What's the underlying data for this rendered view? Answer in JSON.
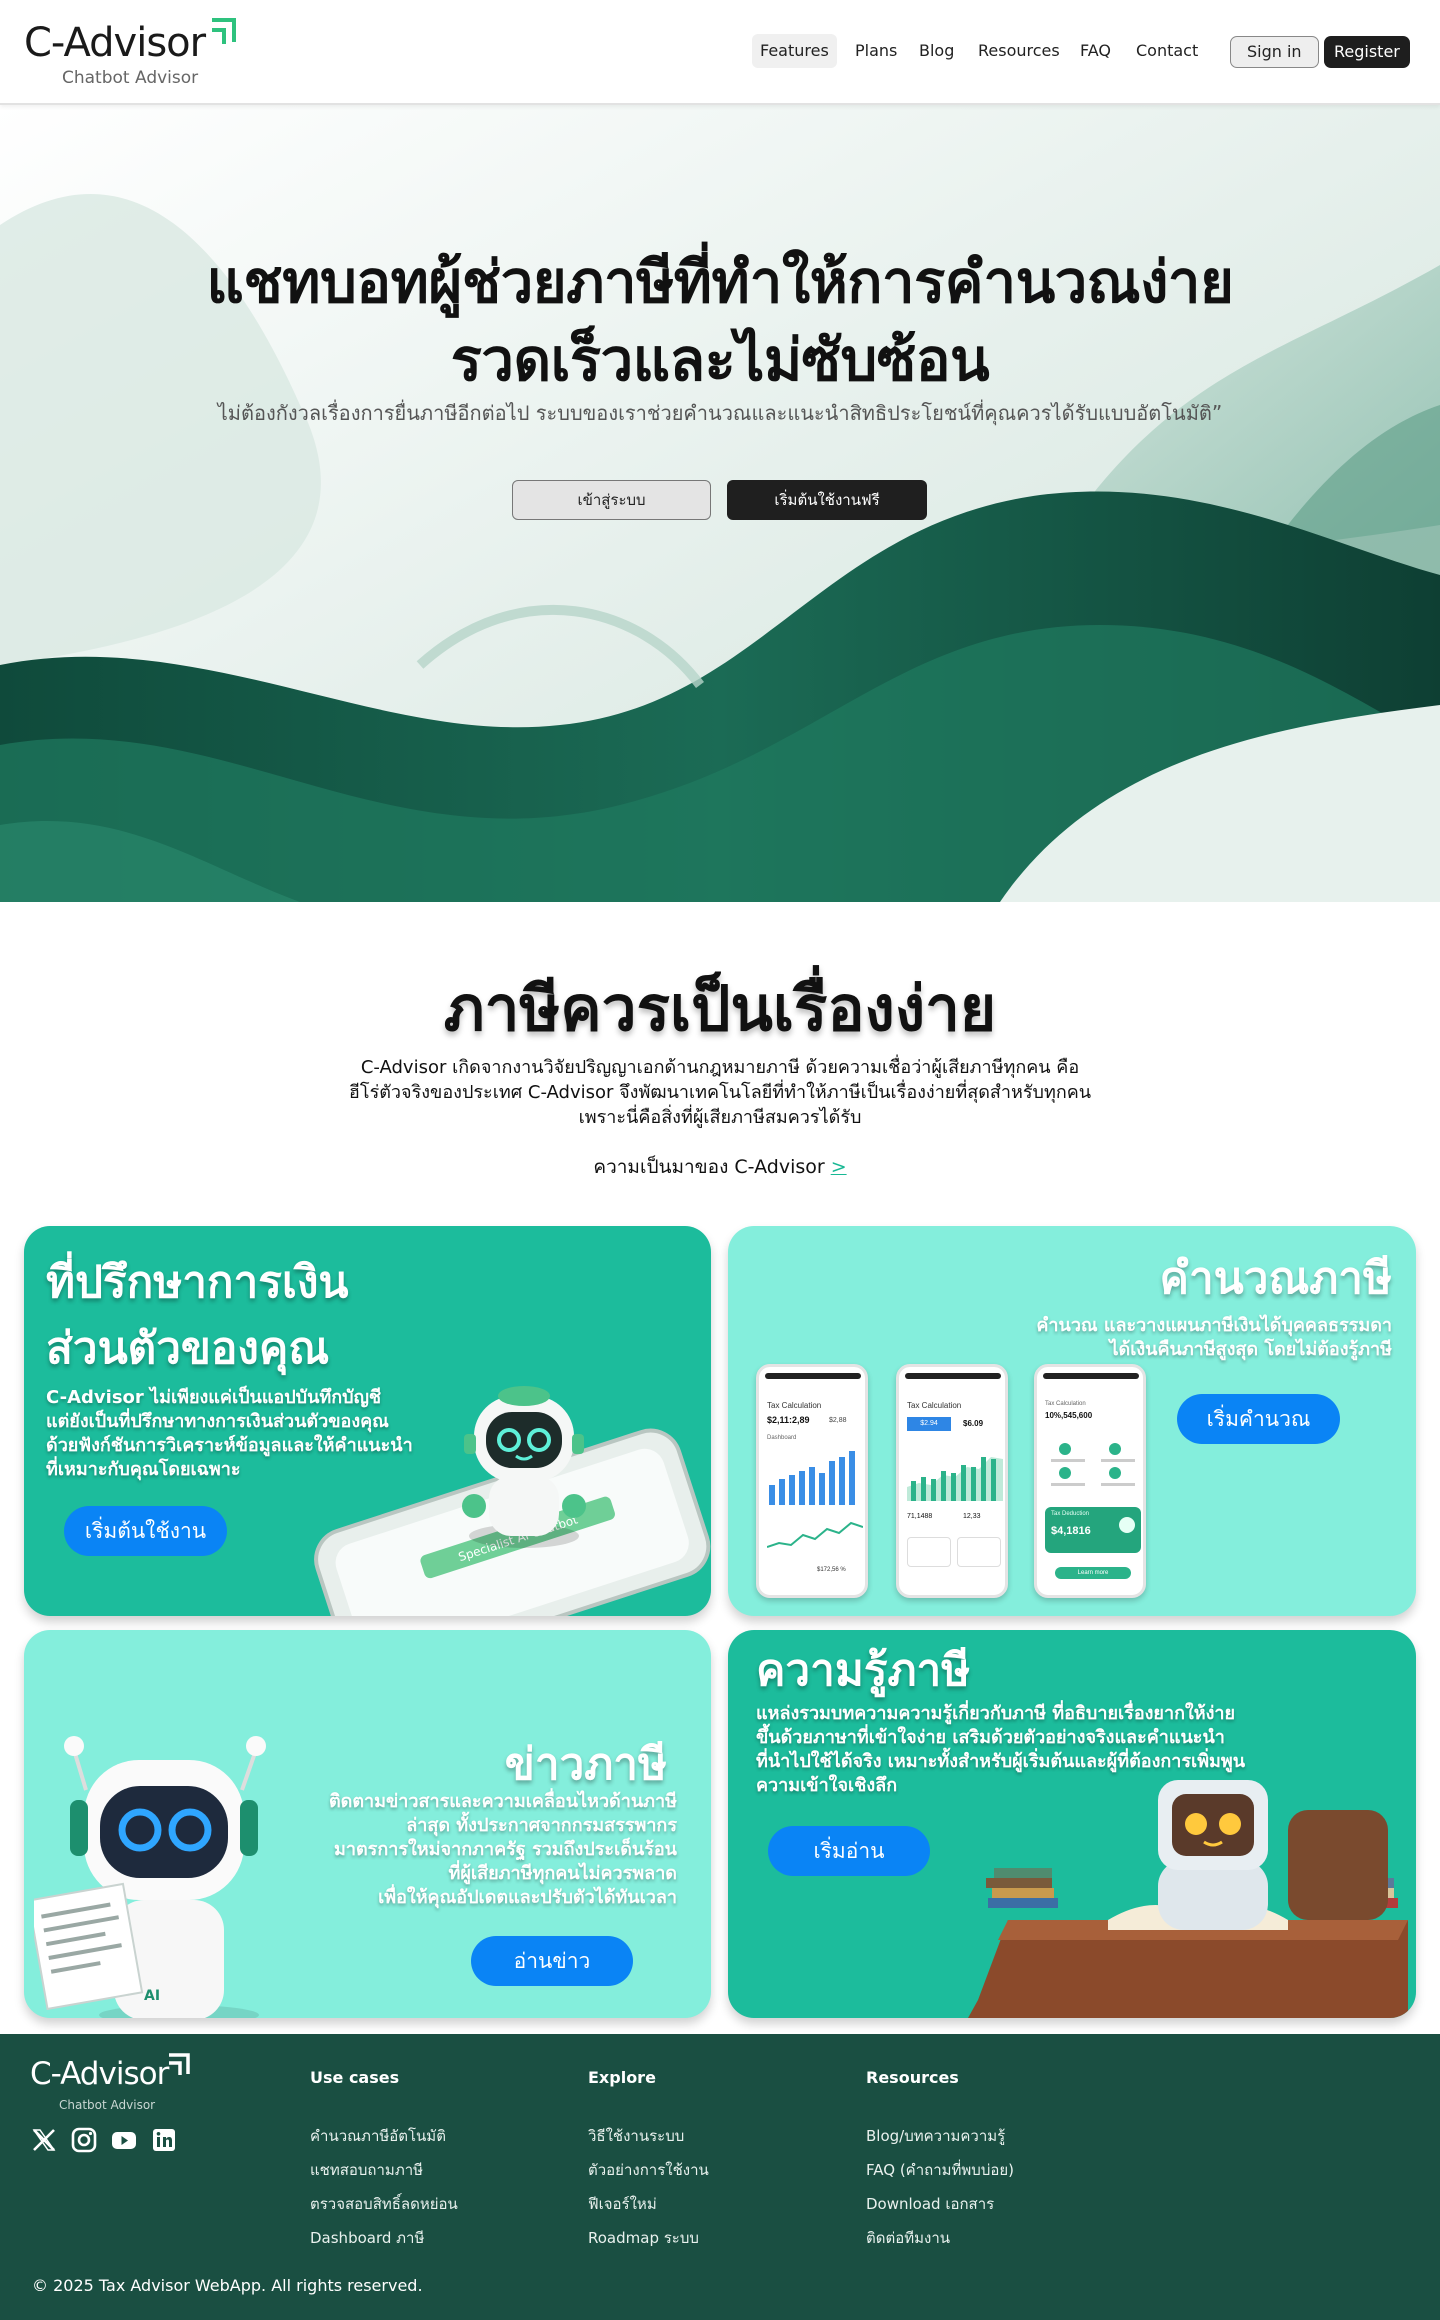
{
  "brand": {
    "name": "C-Advisor",
    "tagline": "Chatbot Advisor"
  },
  "nav": {
    "items": [
      "Features",
      "Plans",
      "Blog",
      "Resources",
      "FAQ",
      "Contact"
    ],
    "active": "Features",
    "signin": "Sign in",
    "register": "Register"
  },
  "hero": {
    "title_line1": "แชทบอทผู้ช่วยภาษีที่ทำให้การคำนวณง่าย",
    "title_line2": "รวดเร็วและไม่ซับซ้อน",
    "subtitle": "ไม่ต้องกังวลเรื่องการยื่นภาษีอีกต่อไป ระบบของเราช่วยคำนวณและแนะนำสิทธิประโยชน์ที่คุณควรได้รับแบบอัตโนมัติ”",
    "login_button": "เข้าสู่ระบบ",
    "start_button": "เริ่มต้นใช้งานฟรี"
  },
  "intro": {
    "title": "ภาษีควรเป็นเรื่องง่าย",
    "text_line1": "C-Advisor เกิดจากงานวิจัยปริญญาเอกด้านกฎหมายภาษี ด้วยความเชื่อว่าผู้เสียภาษีทุกคน คือ",
    "text_line2": "ฮีโร่ตัวจริงของประเทศ C-Advisor จึงพัฒนาเทคโนโลยีที่ทำให้ภาษีเป็นเรื่องง่ายที่สุดสำหรับทุกคน",
    "text_line3": "เพราะนี่คือสิ่งที่ผู้เสียภาษีสมควรได้รับ",
    "link": "ความเป็นมาของ C-Advisor",
    "link_chevron": ">"
  },
  "cards": {
    "advisor": {
      "title_line1": "ที่ปรึกษาการเงิน",
      "title_line2": "ส่วนตัวของคุณ",
      "text_line1": "C-Advisor ไม่เพียงแค่เป็นแอปบันทึกบัญชี",
      "text_line2": "แต่ยังเป็นที่ปรึกษาทางการเงินส่วนตัวของคุณ",
      "text_line3": "ด้วยฟังก์ชันการวิเคราะห์ข้อมูลและให้คำแนะนำ",
      "text_line4": "ที่เหมาะกับคุณโดยเฉพาะ",
      "button": "เริ่มต้นใช้งาน",
      "phone_banner": "Specialist AI Chatbot"
    },
    "calc": {
      "title": "คำนวณภาษี",
      "text_line1": "คำนวณ และวางแผนภาษีเงินได้บุคคลธรรมดา",
      "text_line2": "ได้เงินคืนภาษีสูงสุด โดยไม่ต้องรู้ภาษี",
      "button": "เริ่มคำนวณ",
      "phone1": {
        "header": "Tax Calculation",
        "amount": "$2,11:2,89",
        "small": "$2,88",
        "label": "Dashboard",
        "footer": "$172,56 %"
      },
      "phone2": {
        "header": "Tax Calculation",
        "amount": "$2.94",
        "value": "$6.09",
        "row1": "71,1488",
        "row2": "12,33"
      },
      "phone3": {
        "header": "Tax Calculation",
        "amount": "10%,545,600",
        "card_title": "Tax Deduction",
        "card_amount": "$4,1816",
        "btn": "Learn more"
      }
    },
    "news": {
      "title": "ข่าวภาษี",
      "text_line1": "ติดตามข่าวสารและความเคลื่อนไหวด้านภาษี",
      "text_line2": "ล่าสุด ทั้งประกาศจากกรมสรรพากร",
      "text_line3": "มาตรการใหม่จากภาครัฐ รวมถึงประเด็นร้อน",
      "text_line4": "ที่ผู้เสียภาษีทุกคนไม่ควรพลาด",
      "text_line5": "เพื่อให้คุณอัปเดตและปรับตัวได้ทันเวลา",
      "button": "อ่านข่าว",
      "robot_label": "AI"
    },
    "knowledge": {
      "title": "ความรู้ภาษี",
      "text_line1": "แหล่งรวมบทความความรู้เกี่ยวกับภาษี ที่อธิบายเรื่องยากให้ง่าย",
      "text_line2": "ขึ้นด้วยภาษาที่เข้าใจง่าย เสริมด้วยตัวอย่างจริงและคำแนะนำ",
      "text_line3": "ที่นำไปใช้ได้จริง เหมาะทั้งสำหรับผู้เริ่มต้นและผู้ที่ต้องการเพิ่มพูน",
      "text_line4": "ความเข้าใจเชิงลึก",
      "button": "เริ่มอ่าน"
    }
  },
  "footer": {
    "columns": [
      {
        "title": "Use cases",
        "links": [
          "คำนวณภาษีอัตโนมัติ",
          "แชทสอบถามภาษี",
          "ตรวจสอบสิทธิ์ลดหย่อน",
          "Dashboard ภาษี"
        ]
      },
      {
        "title": "Explore",
        "links": [
          "วิธีใช้งานระบบ",
          "ตัวอย่างการใช้งาน",
          "ฟีเจอร์ใหม่",
          "Roadmap ระบบ"
        ]
      },
      {
        "title": "Resources",
        "links": [
          "Blog/บทความความรู้",
          "FAQ (คำถามที่พบบ่อย)",
          "Download เอกสาร",
          "ติดต่อทีมงาน"
        ]
      }
    ],
    "social": [
      "x-icon",
      "instagram-icon",
      "youtube-icon",
      "linkedin-icon"
    ],
    "copyright": "© 2025 Tax Advisor WebApp. All rights reserved."
  },
  "colors": {
    "card_dark": "#1cbc9c",
    "card_light": "#84eedc",
    "button_blue": "#0a84f5",
    "footer_bg": "#1a4f42",
    "hero_wave": "#1a6450"
  }
}
